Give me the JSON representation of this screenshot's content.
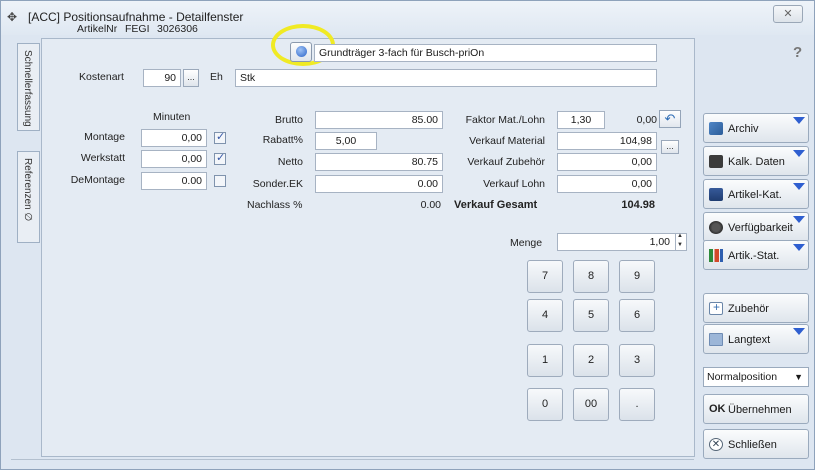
{
  "window": {
    "title": "[ACC] Positionsaufnahme - Detailfenster",
    "close_glyph": "✕"
  },
  "side_tabs": [
    "Schnellerfassung",
    "Referenzen ∅"
  ],
  "article": {
    "nr_label": "ArtikelNr",
    "nr_prefix": "FEGI",
    "nr_value": "3026306",
    "description": "Grundträger 3-fach für Busch-priOn",
    "kostenart_label": "Kostenart",
    "kostenart_value": "90",
    "browse_label": "...",
    "eh_label": "Eh",
    "eh_value": "Stk"
  },
  "time": {
    "header": "Minuten",
    "rows": [
      {
        "label": "Montage",
        "value": "0,00",
        "checked": true
      },
      {
        "label": "Werkstatt",
        "value": "0,00",
        "checked": true
      },
      {
        "label": "DeMontage",
        "value": "0.00",
        "checked": false
      }
    ]
  },
  "prices": {
    "brutto_label": "Brutto",
    "brutto_value": "85.00",
    "rabatt_label": "Rabatt%",
    "rabatt_value": "5,00",
    "netto_label": "Netto",
    "netto_value": "80.75",
    "sonder_label": "Sonder.EK",
    "sonder_value": "0.00",
    "nachlass_label": "Nachlass %",
    "nachlass_value": "0.00"
  },
  "sales": {
    "faktor_label": "Faktor Mat./Lohn",
    "faktor_value": "1,30",
    "faktor_extra": "0,00",
    "material_label": "Verkauf Material",
    "material_value": "104,98",
    "zubehoer_label": "Verkauf Zubehör",
    "zubehoer_value": "0,00",
    "lohn_label": "Verkauf Lohn",
    "lohn_value": "0,00",
    "gesamt_label": "Verkauf Gesamt",
    "gesamt_value": "104.98",
    "reset_glyph": "↶"
  },
  "quantity": {
    "label": "Menge",
    "value": "1,00"
  },
  "keypad": [
    "7",
    "8",
    "9",
    "4",
    "5",
    "6",
    "1",
    "2",
    "3",
    "0",
    "00",
    "."
  ],
  "help_label": "?",
  "right_buttons": {
    "archiv": "Archiv",
    "kalk": "Kalk. Daten",
    "artkat": "Artikel-Kat.",
    "verf": "Verfügbarkeit",
    "stat": "Artik.-Stat.",
    "zubehoer": "Zubehör",
    "langtext": "Langtext",
    "uebernehmen": "Übernehmen",
    "schliessen": "Schließen"
  },
  "ok_glyph": "OK",
  "close_glyph": "✕",
  "position_select": {
    "value": "Normalposition",
    "arrow": "▼"
  }
}
